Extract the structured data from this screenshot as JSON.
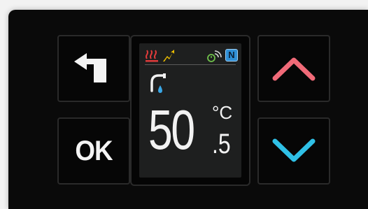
{
  "buttons": {
    "back": {
      "icon": "back-arrow-icon"
    },
    "ok": {
      "label": "OK"
    },
    "up": {
      "icon": "chevron-up-icon",
      "color": "#f06a78"
    },
    "down": {
      "icon": "chevron-down-icon",
      "color": "#2fc0e6"
    }
  },
  "display": {
    "status_icons": [
      "heating-icon",
      "boost-icon",
      "timer-wireless-icon"
    ],
    "mode_badge": "N",
    "shower_icon": "shower-tap-icon",
    "temperature": {
      "integer": "50",
      "unit": "°C",
      "decimal": ".5"
    }
  },
  "colors": {
    "heating": "#e03b3b",
    "boost": "#f2c200",
    "timer": "#6fc04a",
    "badge": "#2f8fd6",
    "water_drop": "#3aa7e6"
  }
}
